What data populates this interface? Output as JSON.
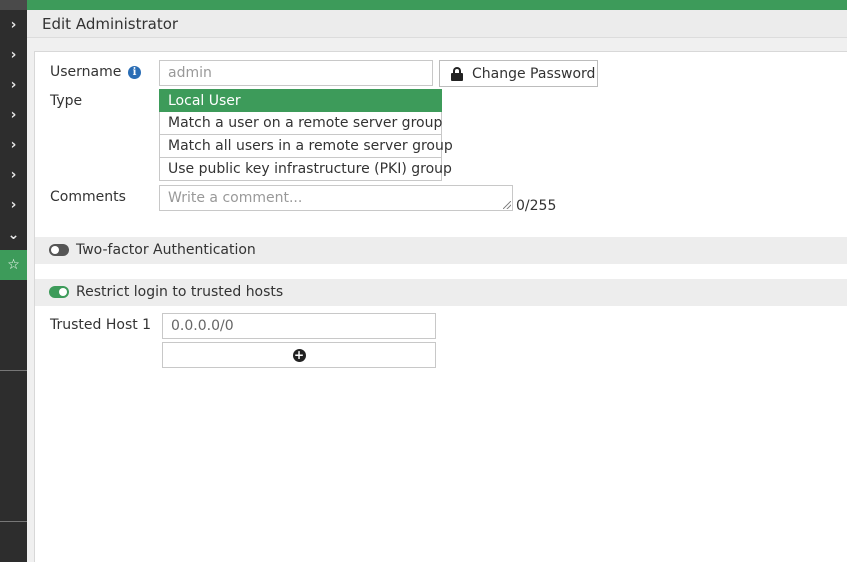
{
  "header": {
    "title": "Edit Administrator"
  },
  "sidebar": {
    "items": [
      {
        "icon": "chevron-right-icon",
        "glyph": "›"
      },
      {
        "icon": "chevron-right-icon",
        "glyph": "›"
      },
      {
        "icon": "chevron-right-icon",
        "glyph": "›"
      },
      {
        "icon": "chevron-right-icon",
        "glyph": "›"
      },
      {
        "icon": "chevron-right-icon",
        "glyph": "›"
      },
      {
        "icon": "chevron-right-icon",
        "glyph": "›"
      },
      {
        "icon": "chevron-right-icon",
        "glyph": "›"
      },
      {
        "icon": "chevron-down-icon",
        "glyph": "⌄"
      },
      {
        "icon": "star-icon",
        "glyph": "☆"
      }
    ],
    "colors": {
      "background": "#2d2d2d",
      "active": "#3d9b5a"
    }
  },
  "form": {
    "username": {
      "label": "Username",
      "info_glyph": "i",
      "placeholder": "admin"
    },
    "change_password": {
      "label": "Change Password"
    },
    "type": {
      "label": "Type",
      "options": [
        "Local User",
        "Match a user on a remote server group",
        "Match all users in a remote server group",
        "Use public key infrastructure (PKI) group"
      ],
      "selected": "Local User"
    },
    "comments": {
      "label": "Comments",
      "placeholder": "Write a comment...",
      "counter": "0/255"
    },
    "two_factor": {
      "label": "Two-factor Authentication",
      "enabled": false
    },
    "restrict_login": {
      "label": "Restrict login to trusted hosts",
      "enabled": true
    },
    "trusted_host_1": {
      "label": "Trusted Host 1",
      "value": "0.0.0.0/0"
    },
    "add_button": {
      "glyph": "+"
    }
  },
  "colors": {
    "accent": "#3d9b5a",
    "info": "#2a6db5"
  }
}
